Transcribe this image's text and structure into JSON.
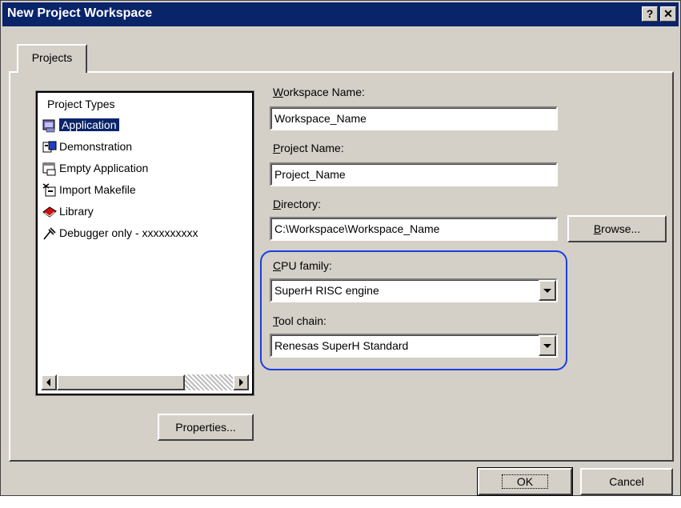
{
  "window": {
    "title": "New Project Workspace",
    "help_button": "?",
    "close_button": "✕"
  },
  "tabs": [
    {
      "label": "Projects"
    }
  ],
  "project_types": {
    "header": "Project Types",
    "items": [
      {
        "label": "Application",
        "icon": "application-icon",
        "selected": true
      },
      {
        "label": "Demonstration",
        "icon": "demonstration-icon",
        "selected": false
      },
      {
        "label": "Empty Application",
        "icon": "empty-application-icon",
        "selected": false
      },
      {
        "label": "Import Makefile",
        "icon": "import-makefile-icon",
        "selected": false
      },
      {
        "label": "Library",
        "icon": "library-icon",
        "selected": false
      },
      {
        "label": "Debugger only - xxxxxxxxxx",
        "icon": "debugger-icon",
        "selected": false
      }
    ]
  },
  "form": {
    "workspace_name_label_key": "W",
    "workspace_name_label_rest": "orkspace Name:",
    "workspace_name_value": "Workspace_Name",
    "project_name_label_key": "P",
    "project_name_label_rest": "roject Name:",
    "project_name_value": "Project_Name",
    "directory_label_key": "D",
    "directory_label_rest": "irectory:",
    "directory_value": "C:\\Workspace\\Workspace_Name",
    "browse_button_key": "B",
    "browse_button_rest": "rowse...",
    "cpu_family_label_key": "C",
    "cpu_family_label_rest": "PU family:",
    "cpu_family_value": "SuperH RISC engine",
    "tool_chain_label_key": "T",
    "tool_chain_label_rest": "ool chain:",
    "tool_chain_value": "Renesas SuperH Standard"
  },
  "buttons": {
    "properties": "Properties...",
    "ok": "OK",
    "cancel": "Cancel"
  },
  "colors": {
    "titlebar": "#0a246a",
    "dialog_face": "#d4d0c8",
    "selection": "#0a246a",
    "highlight_outline": "#1a3fe0"
  }
}
